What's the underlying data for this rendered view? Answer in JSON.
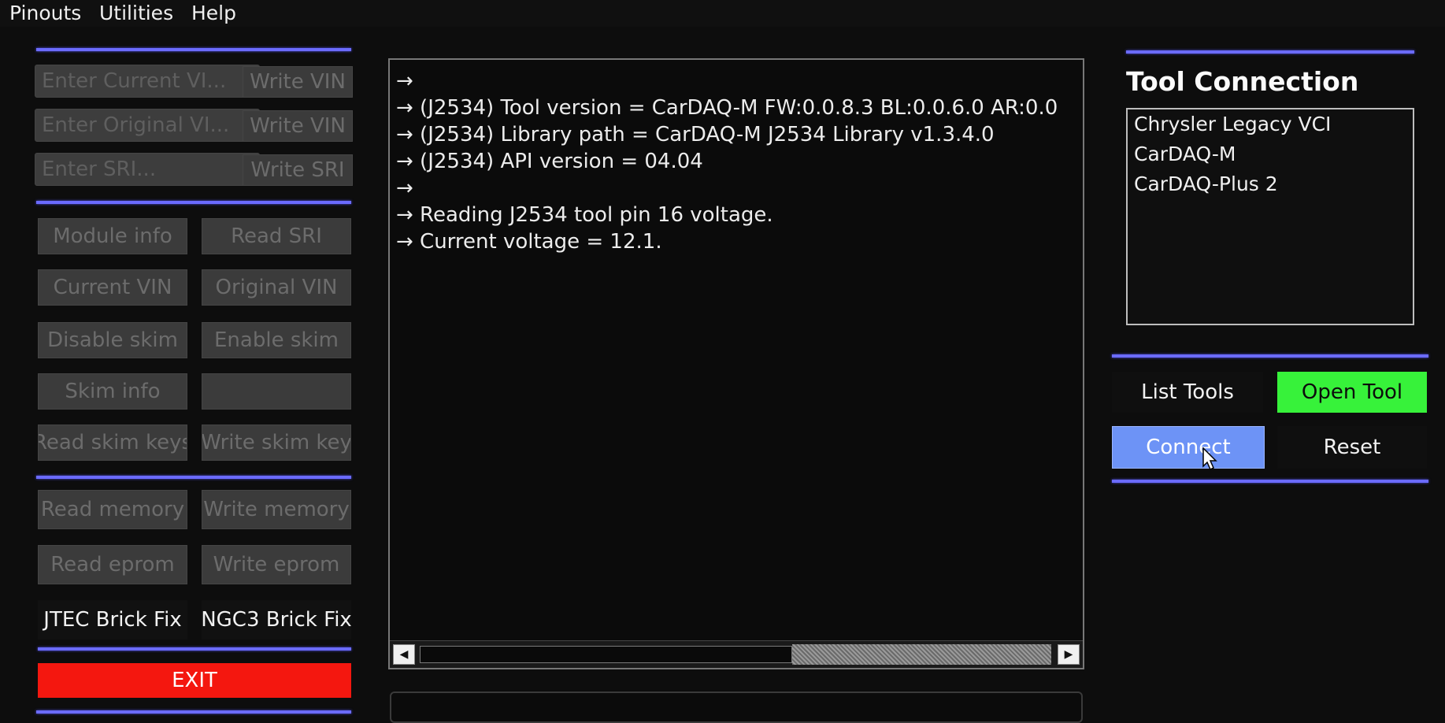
{
  "menu": [
    "Pinouts",
    "Utilities",
    "Help"
  ],
  "left_panel": {
    "inputs": [
      {
        "placeholder": "Enter Current VI...",
        "button": "Write VIN"
      },
      {
        "placeholder": "Enter Original VI...",
        "button": "Write VIN"
      },
      {
        "placeholder": "Enter SRI...",
        "button": "Write SRI"
      }
    ],
    "grid1": [
      [
        "Module info",
        "Read SRI"
      ],
      [
        "Current VIN",
        "Original VIN"
      ],
      [
        "Disable skim",
        "Enable skim"
      ],
      [
        "Skim info",
        ""
      ],
      [
        "Read skim keys",
        "Write skim key"
      ]
    ],
    "grid2": [
      [
        "Read memory",
        "Write memory"
      ],
      [
        "Read eprom",
        "Write eprom"
      ]
    ],
    "brick": [
      "JTEC Brick Fix",
      "NGC3 Brick Fix"
    ],
    "exit": "EXIT"
  },
  "log": {
    "lines": [
      "→",
      "→  (J2534) Tool version = CarDAQ-M FW:0.0.8.3 BL:0.0.6.0 AR:0.0",
      "→  (J2534) Library path = CarDAQ-M J2534 Library v1.3.4.0",
      "→  (J2534) API version = 04.04",
      "→",
      "→ Reading J2534 tool pin 16 voltage.",
      "→ Current voltage = 12.1."
    ],
    "scroll": {
      "left_arrow": "◀",
      "right_arrow": "▶",
      "thumb_fraction": 0.59
    }
  },
  "tool_connection": {
    "title": "Tool Connection",
    "tools": [
      "Chrysler Legacy VCI",
      "CarDAQ-M",
      "CarDAQ-Plus 2"
    ],
    "buttons": {
      "list_tools": "List Tools",
      "open_tool": "Open Tool",
      "connect": "Connect",
      "reset": "Reset"
    }
  },
  "colors": {
    "separator": "#6b6bff",
    "exit": "#f4170f",
    "open_tool": "#37f23a",
    "connect": "#6d93f6"
  }
}
